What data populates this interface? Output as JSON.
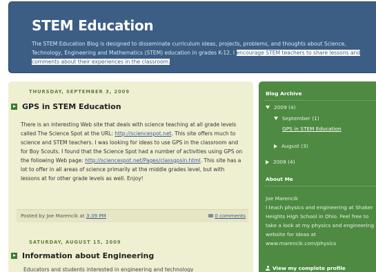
{
  "header": {
    "title": "STEM Education",
    "description_plain": "The STEM Education Blog is designed to disseminate curriculum ideas, projects, problems, and thoughts about Science, Technology, Engineering and Mathematics (STEM) education in grades K-12. I ",
    "description_highlighted": "encourage STEM teachers to share lessons and comments about their experiences in the classroom."
  },
  "posts": [
    {
      "date": "THURSDAY, SEPTEMBER 3, 2009",
      "title": "GPS in STEM Education",
      "body": {
        "t1": "There is an interesting Web site that deals with science teaching at all grade levels called The Science Spot at the URL: ",
        "link1": "http://sciencespot.net",
        "t2": ". This site offers much to science and STEM teachers. I was looking for ideas to use GPS in the classroom and for Boy Scouts. I found that the Science Spot had a number of activities using GPS on the following Web page: ",
        "link2": "http://sciencespot.net/Pages/classgpsin.html",
        "t3": ". This site has a lot to offer in all areas of science primarily at the middle grades level, but with lessons at for other grade levels as well. Enjoy!"
      },
      "footer": {
        "posted_by": "Posted by Joe Marencik at ",
        "time": "3:39 PM",
        "comments": "0 comments"
      }
    },
    {
      "date": "SATURDAY, AUGUST 15, 2009",
      "title": "Information about Engineering",
      "teaser": "Educators and students interested in engineering and technology"
    }
  ],
  "sidebar": {
    "archive_heading": "Blog Archive",
    "archive": {
      "year_2009": "2009 (4)",
      "september": "September (1)",
      "september_post": "GPS in STEM Education",
      "august": "August (3)",
      "year_2008": "2008 (4)"
    },
    "about_heading": "About Me",
    "about_text": "Joe Marencik\nI teach physics and engineering at Shaker Heights High School in Ohio. Feel free to take a look at my physics and engineering website for ideas at www.marencik.com/physics",
    "view_profile": "View my complete profile"
  },
  "icons": {
    "post_title_icon": "post-arrow-icon",
    "comment_icon": "comment-icon",
    "expand_icon": "triangle-down-icon",
    "collapse_icon": "triangle-right-icon",
    "profile_icon": "person-icon"
  },
  "colors": {
    "header_bg": "#3c5e84",
    "main_bg": "#efefd2",
    "sidebar_bg": "#4e8a42",
    "date_color": "#5f7f3a",
    "link_color": "#3a5a9a"
  }
}
